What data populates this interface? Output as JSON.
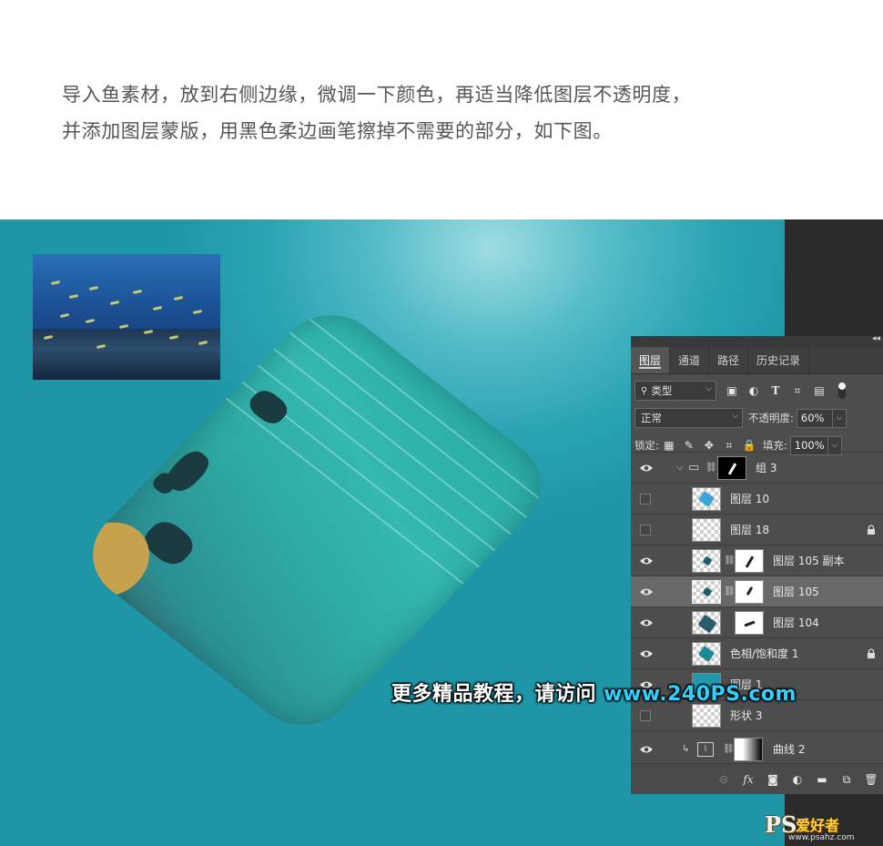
{
  "caption": {
    "line1": "导入鱼素材，放到右侧边缘，微调一下颜色，再适当降低图层不透明度，",
    "line2": "并添加图层蒙版，用黑色柔边画笔擦掉不需要的部分，如下图。"
  },
  "banner": {
    "text_cn": "更多精品教程，请访问 ",
    "url": "www.240PS.com"
  },
  "panel": {
    "tabs": [
      "图层",
      "通道",
      "路径",
      "历史记录"
    ],
    "active_tab": "图层",
    "filter": {
      "kind": "类型"
    },
    "filter_icons": [
      "image-filter-icon",
      "adjustment-filter-icon",
      "type-filter-icon",
      "shape-filter-icon",
      "smartobject-filter-icon",
      "filter-toggle-icon"
    ],
    "blend_mode": "正常",
    "opacity_label": "不透明度:",
    "opacity_value": "60%",
    "lock_label": "锁定:",
    "fill_label": "填充:",
    "fill_value": "100%",
    "layers": [
      {
        "name": "组 3",
        "visible": true,
        "type": "group",
        "mask": "black"
      },
      {
        "name": "图层 10",
        "visible": false,
        "type": "pixel"
      },
      {
        "name": "图层 18",
        "visible": false,
        "type": "pixel",
        "locked": true
      },
      {
        "name": "图层 105 副本",
        "visible": true,
        "type": "pixel",
        "mask": "white"
      },
      {
        "name": "图层 105",
        "visible": true,
        "type": "pixel",
        "mask": "white",
        "selected": true
      },
      {
        "name": "图层 104",
        "visible": true,
        "type": "smart",
        "mask": "white"
      },
      {
        "name": "色相/饱和度 1",
        "visible": true,
        "type": "pixel",
        "locked": true
      },
      {
        "name": "图层 1",
        "visible": true,
        "type": "pixel"
      },
      {
        "name": "形状 3",
        "visible": false,
        "type": "shape"
      },
      {
        "name": "曲线 2",
        "visible": true,
        "type": "curves",
        "mask": "gradient"
      }
    ],
    "bottom_icons": [
      "link-layers-icon",
      "fx-icon",
      "add-mask-icon",
      "adjustment-layer-icon",
      "new-group-icon",
      "new-layer-icon",
      "delete-layer-icon"
    ]
  },
  "watermark": {
    "logo": "PS",
    "cn": "爱好者",
    "url": "www.psahz.com"
  },
  "colors": {
    "background_teal": "#2aa3b3",
    "panel_bg": "#4d4d4d",
    "banner_url": "#2fd1ff"
  }
}
